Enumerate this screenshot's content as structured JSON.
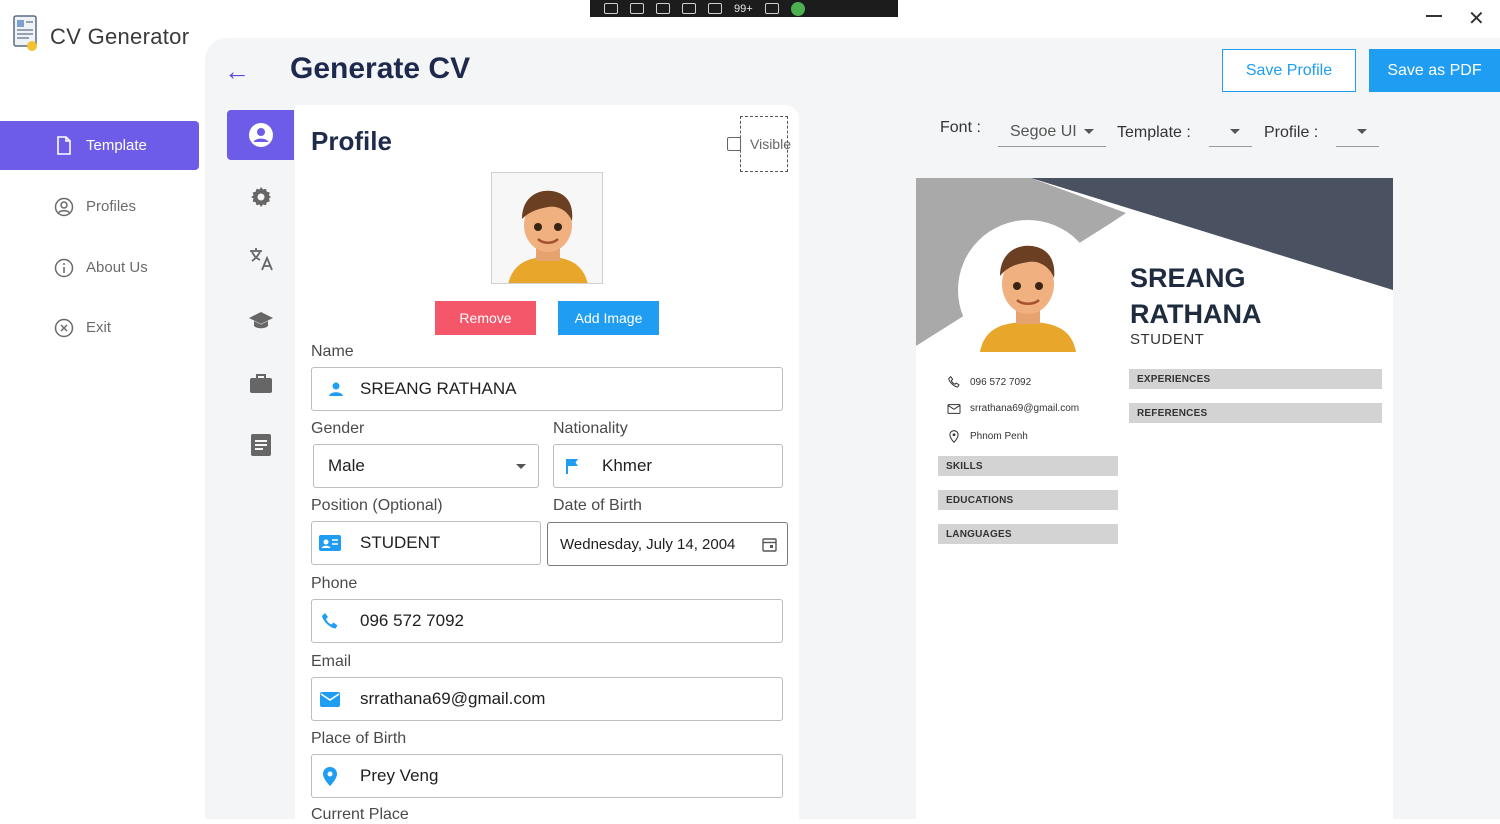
{
  "app": {
    "title": "CV Generator"
  },
  "overlay": {
    "count_badge": "99+"
  },
  "nav": {
    "items": [
      {
        "label": "Template",
        "icon": "document-icon",
        "active": true
      },
      {
        "label": "Profiles",
        "icon": "user-circle-icon",
        "active": false
      },
      {
        "label": "About Us",
        "icon": "info-icon",
        "active": false
      },
      {
        "label": "Exit",
        "icon": "close-circle-icon",
        "active": false
      }
    ]
  },
  "header": {
    "title": "Generate CV",
    "save_profile_label": "Save Profile",
    "save_pdf_label": "Save as PDF"
  },
  "tabs": [
    "profile-icon",
    "settings-icon",
    "translate-icon",
    "education-icon",
    "briefcase-icon",
    "notes-icon"
  ],
  "form": {
    "section_title": "Profile",
    "visible_label": "Visible",
    "visible_checked": false,
    "remove_label": "Remove",
    "add_image_label": "Add Image",
    "name": {
      "label": "Name",
      "value": "SREANG RATHANA"
    },
    "gender": {
      "label": "Gender",
      "value": "Male"
    },
    "nationality": {
      "label": "Nationality",
      "value": "Khmer"
    },
    "position": {
      "label": "Position (Optional)",
      "value": "STUDENT"
    },
    "dob": {
      "label": "Date of Birth",
      "value": "Wednesday, July 14, 2004"
    },
    "phone": {
      "label": "Phone",
      "value": "096 572 7092"
    },
    "email": {
      "label": "Email",
      "value": "srrathana69@gmail.com"
    },
    "place_of_birth": {
      "label": "Place of Birth",
      "value": "Prey Veng"
    },
    "current_place": {
      "label": "Current Place"
    }
  },
  "preview_controls": {
    "font_label": "Font :",
    "font_value": "Segoe UI",
    "template_label": "Template :",
    "template_value": "",
    "profile_label": "Profile :",
    "profile_value": ""
  },
  "cv": {
    "name_line1": "SREANG",
    "name_line2": "RATHANA",
    "role": "STUDENT",
    "phone": "096 572 7092",
    "email": "srrathana69@gmail.com",
    "address": "Phnom Penh",
    "left_sections": [
      "SKILLS",
      "EDUCATIONS",
      "LANGUAGES"
    ],
    "right_sections": [
      "EXPERIENCES",
      "REFERENCES"
    ]
  },
  "colors": {
    "accent": "#6c5ce7",
    "primary_button": "#1e9df2",
    "danger_button": "#f4566a",
    "title_text": "#1d2a4d",
    "cv_dark_band": "#4a5262",
    "cv_grey_band": "#a9a9a9"
  }
}
